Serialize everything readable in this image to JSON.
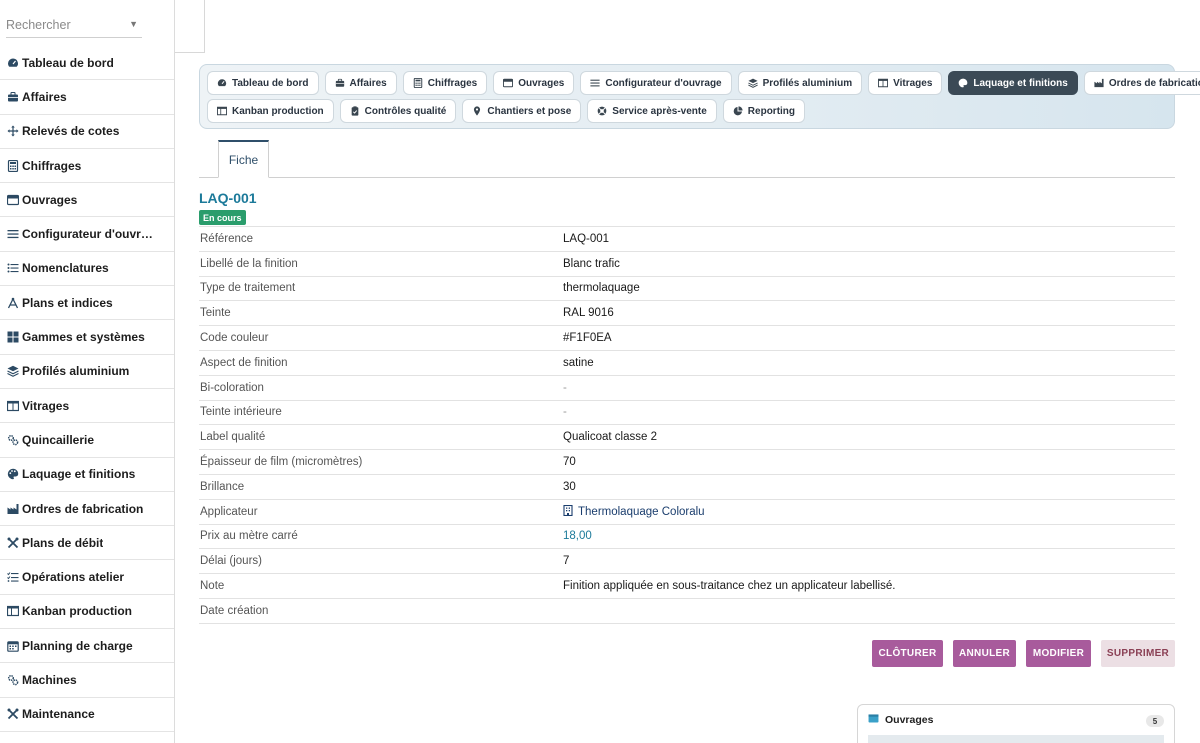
{
  "search": {
    "placeholder": "Rechercher"
  },
  "sidebar": {
    "items": [
      {
        "label": "Tableau de bord",
        "icon": "gauge-icon"
      },
      {
        "label": "Affaires",
        "icon": "briefcase-icon"
      },
      {
        "label": "Relevés de cotes",
        "icon": "move-arrows-icon"
      },
      {
        "label": "Chiffrages",
        "icon": "calculator-icon"
      },
      {
        "label": "Ouvrages",
        "icon": "window-icon"
      },
      {
        "label": "Configurateur d'ouvr…",
        "icon": "sliders-icon"
      },
      {
        "label": "Nomenclatures",
        "icon": "list-icon"
      },
      {
        "label": "Plans et indices",
        "icon": "compass-icon"
      },
      {
        "label": "Gammes et systèmes",
        "icon": "grid-icon"
      },
      {
        "label": "Profilés aluminium",
        "icon": "layers-icon"
      },
      {
        "label": "Vitrages",
        "icon": "glazing-icon"
      },
      {
        "label": "Quincaillerie",
        "icon": "gears-icon"
      },
      {
        "label": "Laquage et finitions",
        "icon": "palette-icon"
      },
      {
        "label": "Ordres de fabrication",
        "icon": "factory-icon"
      },
      {
        "label": "Plans de débit",
        "icon": "tools-icon"
      },
      {
        "label": "Opérations atelier",
        "icon": "tasks-icon"
      },
      {
        "label": "Kanban production",
        "icon": "kanban-icon"
      },
      {
        "label": "Planning de charge",
        "icon": "calendar-icon"
      },
      {
        "label": "Machines",
        "icon": "gears-icon"
      },
      {
        "label": "Maintenance",
        "icon": "tools-icon"
      }
    ]
  },
  "module_tabs": {
    "row1": [
      {
        "label": "Tableau de bord",
        "icon": "gauge-icon"
      },
      {
        "label": "Affaires",
        "icon": "briefcase-icon"
      },
      {
        "label": "Chiffrages",
        "icon": "calculator-icon"
      },
      {
        "label": "Ouvrages",
        "icon": "window-icon"
      },
      {
        "label": "Configurateur d'ouvrage",
        "icon": "sliders-icon"
      },
      {
        "label": "Profilés aluminium",
        "icon": "layers-icon"
      },
      {
        "label": "Vitrages",
        "icon": "glazing-icon"
      },
      {
        "label": "Laquage et finitions",
        "icon": "palette-icon",
        "active": true
      },
      {
        "label": "Ordres de fabrication",
        "icon": "factory-icon"
      }
    ],
    "row2": [
      {
        "label": "Kanban production",
        "icon": "kanban-icon"
      },
      {
        "label": "Contrôles qualité",
        "icon": "clipboard-icon"
      },
      {
        "label": "Chantiers et pose",
        "icon": "map-marker-icon"
      },
      {
        "label": "Service après-vente",
        "icon": "lifebuoy-icon"
      },
      {
        "label": "Reporting",
        "icon": "pie-chart-icon"
      }
    ]
  },
  "detail_tabs": {
    "fiche": "Fiche"
  },
  "record": {
    "title": "LAQ-001",
    "status": "En cours",
    "fields": [
      {
        "label": "Référence",
        "value": "LAQ-001"
      },
      {
        "label": "Libellé de la finition",
        "value": "Blanc trafic"
      },
      {
        "label": "Type de traitement",
        "value": "thermolaquage"
      },
      {
        "label": "Teinte",
        "value": "RAL 9016"
      },
      {
        "label": "Code couleur",
        "value": "#F1F0EA"
      },
      {
        "label": "Aspect de finition",
        "value": "satine"
      },
      {
        "label": "Bi-coloration",
        "value": "-",
        "kind": "dash"
      },
      {
        "label": "Teinte intérieure",
        "value": "-",
        "kind": "dash"
      },
      {
        "label": "Label qualité",
        "value": "Qualicoat classe 2"
      },
      {
        "label": "Épaisseur de film (micromètres)",
        "value": "70"
      },
      {
        "label": "Brillance",
        "value": "30"
      },
      {
        "label": "Applicateur",
        "value": "Thermolaquage Coloralu",
        "kind": "link"
      },
      {
        "label": "Prix au mètre carré",
        "value": "18,00",
        "kind": "money"
      },
      {
        "label": "Délai (jours)",
        "value": "7"
      },
      {
        "label": "Note",
        "value": "Finition appliquée en sous-traitance chez un applicateur labellisé."
      },
      {
        "label": "Date création",
        "value": ""
      }
    ]
  },
  "actions": {
    "cloturer": "CLÔTURER",
    "annuler": "ANNULER",
    "modifier": "MODIFIER",
    "supprimer": "SUPPRIMER"
  },
  "related": {
    "ouvrages": {
      "title": "Ouvrages",
      "count": "5"
    }
  },
  "colors": {
    "accent_title": "#1c7a9a",
    "status_green": "#2a9d6c",
    "action_purple": "#a85b9c",
    "danger_light": "#ecdfe4",
    "active_tab": "#3b4a56"
  }
}
